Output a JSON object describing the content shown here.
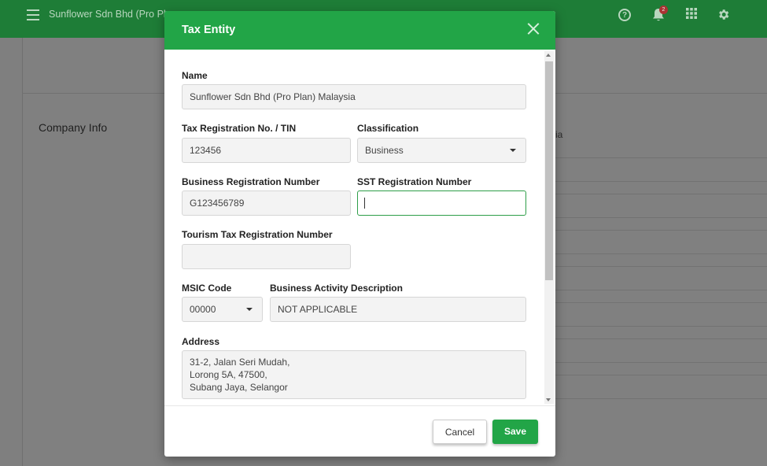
{
  "app": {
    "title": "Sunflower Sdn Bhd (Pro Plan",
    "notification_count": "2"
  },
  "background": {
    "section_title": "Company Info",
    "partial_text": "ia"
  },
  "modal": {
    "title": "Tax Entity",
    "fields": {
      "name": {
        "label": "Name",
        "value": "Sunflower Sdn Bhd (Pro Plan) Malaysia"
      },
      "tin": {
        "label": "Tax Registration No. / TIN",
        "value": "123456"
      },
      "classification": {
        "label": "Classification",
        "value": "Business"
      },
      "brn": {
        "label": "Business Registration Number",
        "value": "G123456789"
      },
      "sst": {
        "label": "SST Registration Number",
        "value": ""
      },
      "tourism": {
        "label": "Tourism Tax Registration Number",
        "value": ""
      },
      "msic": {
        "label": "MSIC Code",
        "value": "00000"
      },
      "activity": {
        "label": "Business Activity Description",
        "value": "NOT APPLICABLE"
      },
      "address": {
        "label": "Address",
        "line1": "31-2, Jalan Seri Mudah,",
        "line2": "Lorong 5A, 47500,",
        "line3": "Subang Jaya, Selangor"
      }
    },
    "buttons": {
      "cancel": "Cancel",
      "save": "Save"
    }
  },
  "colors": {
    "primary_green": "#22a547",
    "topbar_dimmed": "#1e7d37"
  }
}
